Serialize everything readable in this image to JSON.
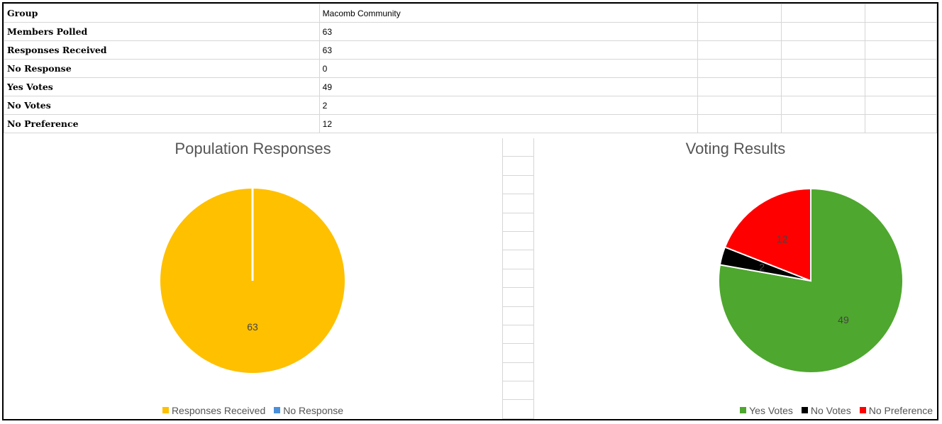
{
  "table": {
    "rows": [
      {
        "label": "Group",
        "value": "Macomb Community"
      },
      {
        "label": "Members Polled",
        "value": "63"
      },
      {
        "label": "Responses Received",
        "value": "63"
      },
      {
        "label": "No Response",
        "value": "0"
      },
      {
        "label": "Yes Votes",
        "value": "49"
      },
      {
        "label": "No Votes",
        "value": "2"
      },
      {
        "label": "No Preference",
        "value": "12"
      }
    ]
  },
  "chart_data": [
    {
      "type": "pie",
      "title": "Population Responses",
      "categories": [
        "Responses Received",
        "No Response"
      ],
      "values": [
        63,
        0
      ],
      "colors": [
        "#FFC000",
        "#4A90D9"
      ],
      "data_labels": [
        "63",
        ""
      ],
      "legend": "bottom"
    },
    {
      "type": "pie",
      "title": "Voting Results",
      "categories": [
        "Yes Votes",
        "No Votes",
        "No Preference"
      ],
      "values": [
        49,
        2,
        12
      ],
      "colors": [
        "#4EA72E",
        "#000000",
        "#FF0000"
      ],
      "data_labels": [
        "49",
        "2",
        "12"
      ],
      "legend": "bottom"
    }
  ]
}
